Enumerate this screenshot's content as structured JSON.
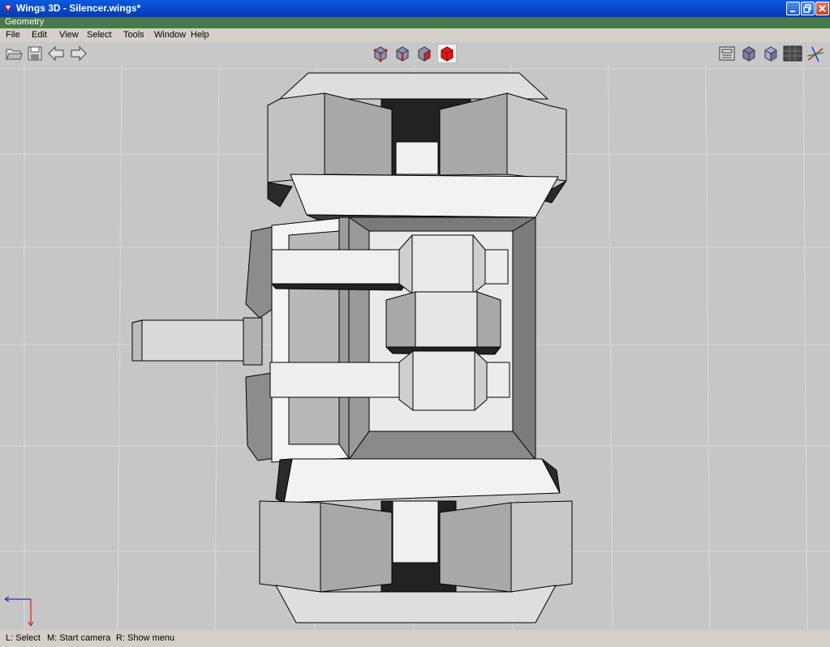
{
  "window": {
    "title": "Wings 3D - Silencer.wings*"
  },
  "docbar": {
    "label": "Geometry"
  },
  "menu": [
    "File",
    "Edit",
    "View",
    "Select",
    "Tools",
    "Window",
    "Help"
  ],
  "toolbar": {
    "left": [
      "open-folder-icon",
      "save-icon",
      "undo-arrow-icon",
      "redo-arrow-icon"
    ],
    "selection_modes": [
      "vertex-mode",
      "edge-mode",
      "face-mode",
      "body-mode"
    ],
    "right": [
      "wireframe-toggle",
      "smooth-shading",
      "flat-shading",
      "ground-grid",
      "axes-toggle"
    ]
  },
  "status": {
    "l": "L: Select",
    "m": "M: Start camera",
    "r": "R: Show menu"
  },
  "colors": {
    "title_bar": "#0646c8",
    "doc_bar": "#467a46",
    "active_mode": "#d81010",
    "viewport": "#c6c6c6"
  }
}
